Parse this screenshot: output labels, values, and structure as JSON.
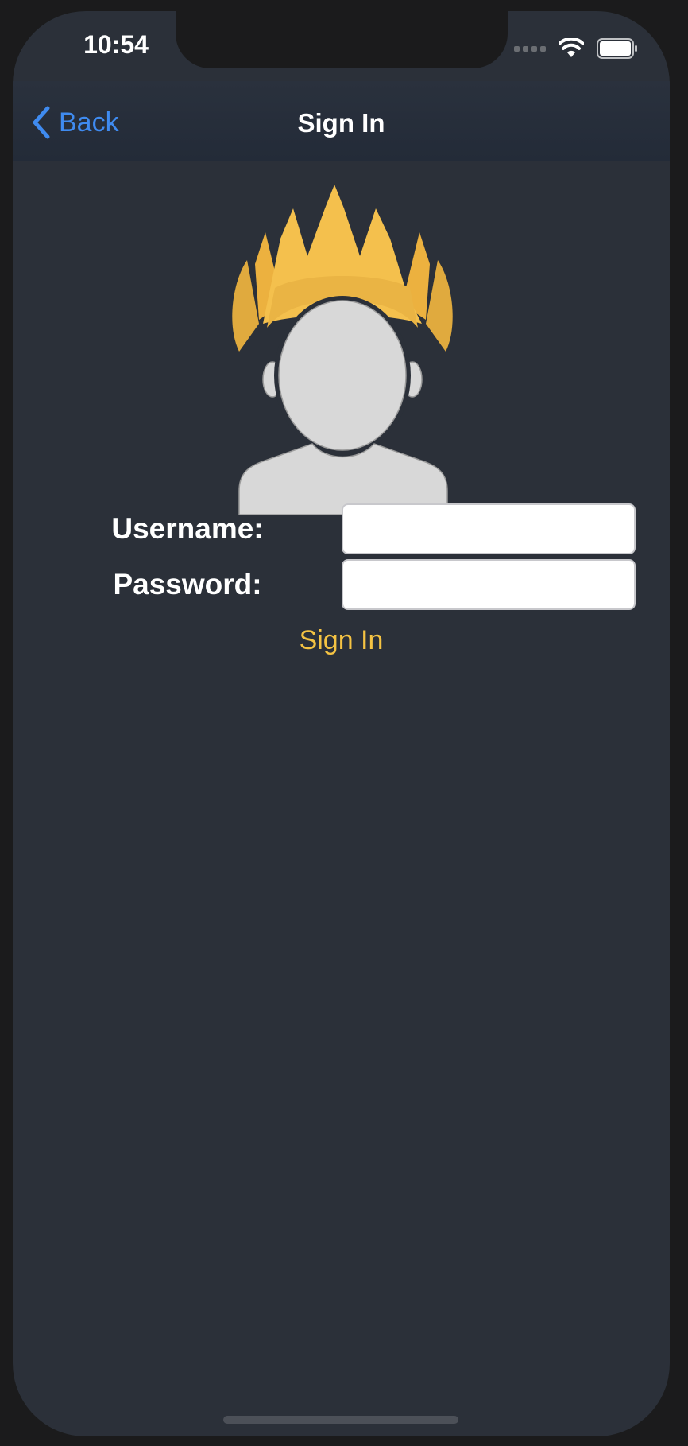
{
  "status_bar": {
    "time": "10:54",
    "icons": [
      "cellular-signal-icon",
      "wifi-icon",
      "battery-icon"
    ]
  },
  "navbar": {
    "back_label": "Back",
    "title": "Sign In"
  },
  "avatar": {
    "icon": "user-avatar-with-crown-hair-icon"
  },
  "form": {
    "username_label": "Username:",
    "username_value": "",
    "password_label": "Password:",
    "password_value": "",
    "signin_label": "Sign In"
  },
  "colors": {
    "background": "#2b3039",
    "navbar": "#232b38",
    "link_blue": "#3f8bf0",
    "accent_yellow": "#f5c343",
    "avatar_gray": "#d8d8d8"
  }
}
